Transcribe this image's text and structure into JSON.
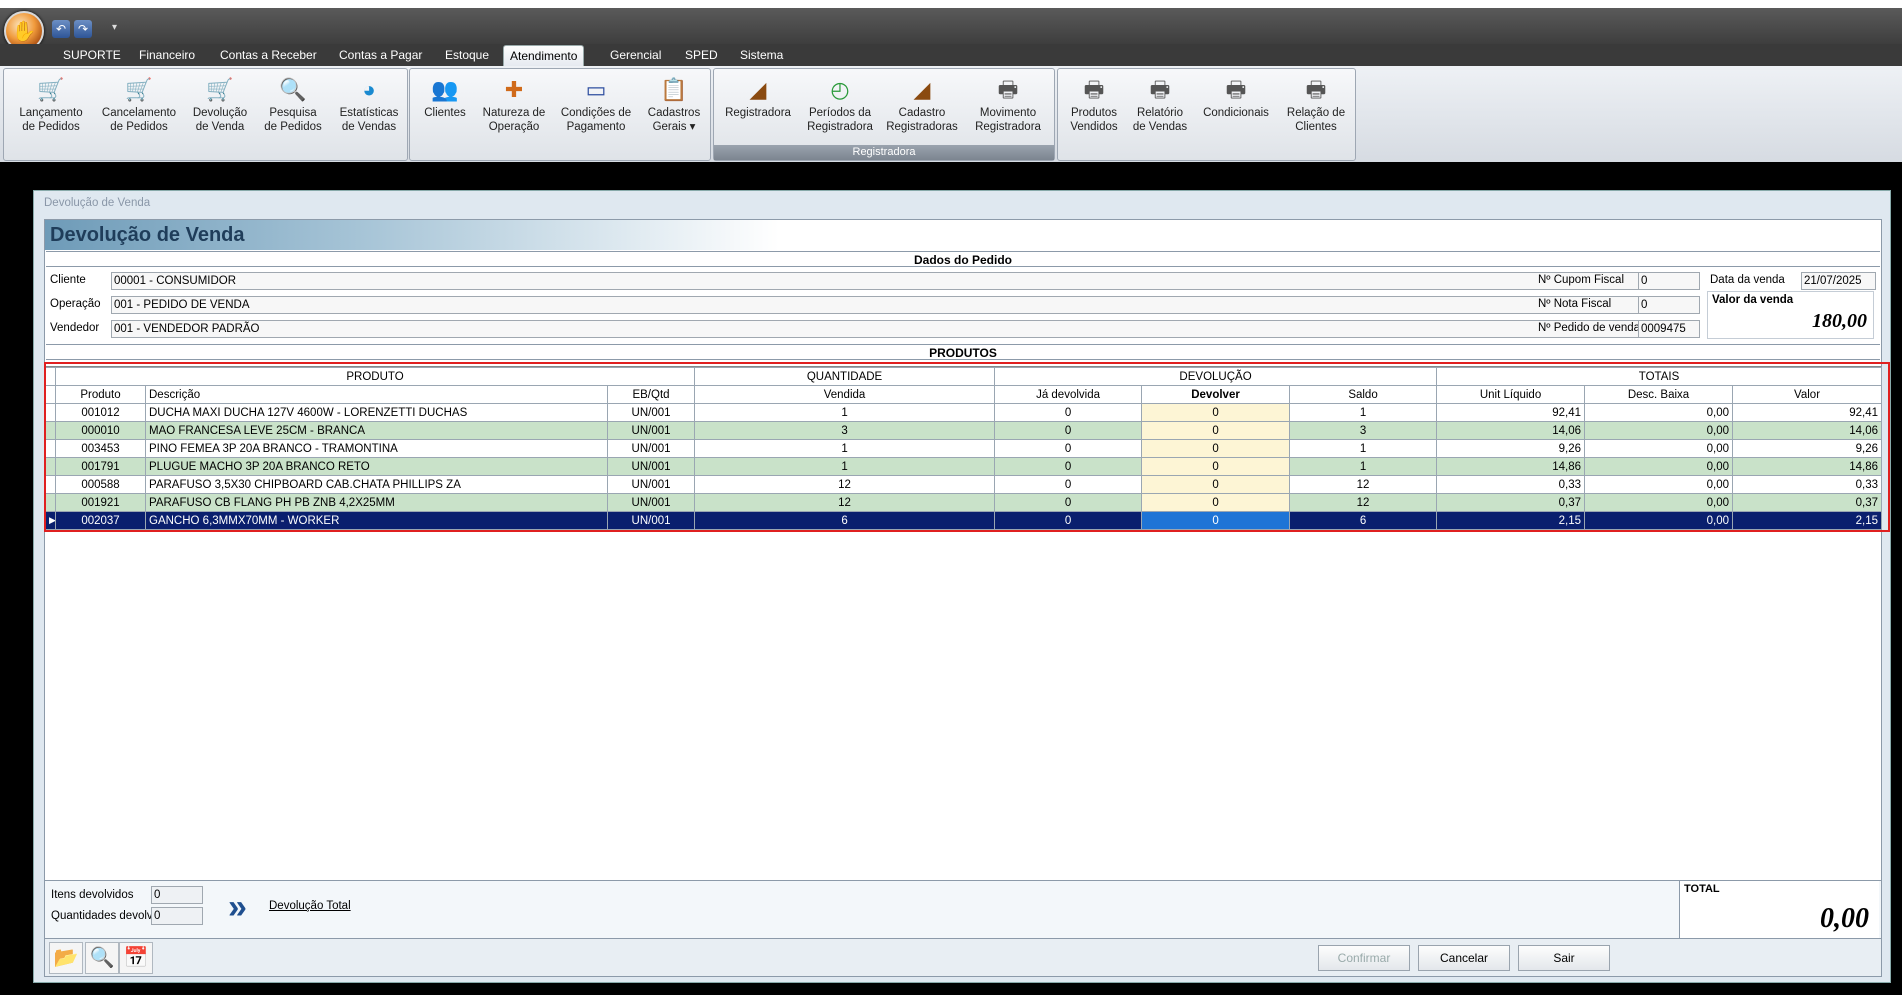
{
  "tabs": [
    "SUPORTE",
    "Financeiro",
    "Contas a Receber",
    "Contas a Pagar",
    "Estoque",
    "Atendimento",
    "Gerencial",
    "SPED",
    "Sistema"
  ],
  "active_tab": "Atendimento",
  "ribbon": {
    "g1": [
      {
        "l1": "Lançamento",
        "l2": "de Pedidos",
        "icon": "cart-icon"
      },
      {
        "l1": "Cancelamento",
        "l2": "de Pedidos",
        "icon": "cart-cancel-icon"
      },
      {
        "l1": "Devolução",
        "l2": "de Venda",
        "icon": "cart-return-icon"
      },
      {
        "l1": "Pesquisa",
        "l2": "de Pedidos",
        "icon": "search-doc-icon"
      },
      {
        "l1": "Estatísticas",
        "l2": "de Vendas",
        "icon": "pie-chart-icon"
      }
    ],
    "g2": [
      {
        "l1": "Clientes",
        "l2": "",
        "icon": "people-icon"
      },
      {
        "l1": "Natureza de",
        "l2": "Operação",
        "icon": "puzzle-icon"
      },
      {
        "l1": "Condições de",
        "l2": "Pagamento",
        "icon": "card-icon"
      },
      {
        "l1": "Cadastros",
        "l2": "Gerais ▾",
        "icon": "clipboard-icon"
      }
    ],
    "g3": [
      {
        "l1": "Registradora",
        "l2": "",
        "icon": "register-icon"
      },
      {
        "l1": "Períodos da",
        "l2": "Registradora",
        "icon": "clock-24-icon"
      },
      {
        "l1": "Cadastro",
        "l2": "Registradoras",
        "icon": "register-icon"
      },
      {
        "l1": "Movimento",
        "l2": "Registradora",
        "icon": "printer-icon"
      }
    ],
    "g3_label": "Registradora",
    "g4": [
      {
        "l1": "Produtos",
        "l2": "Vendidos",
        "icon": "printer-icon"
      },
      {
        "l1": "Relatório",
        "l2": "de Vendas",
        "icon": "printer-icon"
      },
      {
        "l1": "Condicionais",
        "l2": "",
        "icon": "printer-icon"
      },
      {
        "l1": "Relação de",
        "l2": "Clientes",
        "icon": "printer-icon"
      }
    ]
  },
  "window_title": "Devolução de Venda",
  "page_title": "Devolução de Venda",
  "dados_title": "Dados do Pedido",
  "cliente_label": "Cliente",
  "cliente": "00001 - CONSUMIDOR",
  "operacao_label": "Operação",
  "operacao": "001 - PEDIDO DE VENDA",
  "vendedor_label": "Vendedor",
  "vendedor": "001 - VENDEDOR PADRÃO",
  "cupom_label": "Nº Cupom Fiscal",
  "cupom": "0",
  "nota_label": "Nº Nota Fiscal",
  "nota": "0",
  "pedido_label": "Nº Pedido de venda",
  "pedido": "0009475",
  "data_label": "Data da venda",
  "data": "21/07/2025",
  "valor_label": "Valor da venda",
  "valor": "180,00",
  "produtos_title": "PRODUTOS",
  "group_headers": [
    "PRODUTO",
    "QUANTIDADE",
    "DEVOLUÇÃO",
    "TOTAIS"
  ],
  "columns": [
    "Produto",
    "Descrição",
    "EB/Qtd",
    "Vendida",
    "Já devolvida",
    "Devolver",
    "Saldo",
    "Unit Líquido",
    "Desc. Baixa",
    "Valor"
  ],
  "rows": [
    [
      "001012",
      "DUCHA MAXI DUCHA 127V 4600W - LORENZETTI DUCHAS",
      "UN/001",
      "1",
      "0",
      "0",
      "1",
      "92,41",
      "0,00",
      "92,41"
    ],
    [
      "000010",
      "MAO FRANCESA LEVE 25CM - BRANCA",
      "UN/001",
      "3",
      "0",
      "0",
      "3",
      "14,06",
      "0,00",
      "14,06"
    ],
    [
      "003453",
      "PINO FEMEA 3P 20A BRANCO - TRAMONTINA",
      "UN/001",
      "1",
      "0",
      "0",
      "1",
      "9,26",
      "0,00",
      "9,26"
    ],
    [
      "001791",
      "PLUGUE MACHO 3P 20A BRANCO RETO",
      "UN/001",
      "1",
      "0",
      "0",
      "1",
      "14,86",
      "0,00",
      "14,86"
    ],
    [
      "000588",
      "PARAFUSO 3,5X30 CHIPBOARD CAB.CHATA PHILLIPS ZA",
      "UN/001",
      "12",
      "0",
      "0",
      "12",
      "0,33",
      "0,00",
      "0,33"
    ],
    [
      "001921",
      "PARAFUSO CB FLANG PH PB ZNB 4,2X25MM",
      "UN/001",
      "12",
      "0",
      "0",
      "12",
      "0,37",
      "0,00",
      "0,37"
    ],
    [
      "002037",
      "GANCHO 6,3MMX70MM - WORKER",
      "UN/001",
      "6",
      "0",
      "0",
      "6",
      "2,15",
      "0,00",
      "2,15"
    ]
  ],
  "selected_row": 6,
  "itens_label": "Itens devolvidos",
  "itens": "0",
  "qtd_label": "Quantidades devolvidas",
  "qtd": "0",
  "devolucao_total": "Devolução Total",
  "total_label": "TOTAL",
  "total": "0,00",
  "buttons": {
    "confirmar": "Confirmar",
    "cancelar": "Cancelar",
    "sair": "Sair"
  },
  "colors": {
    "row_alt": "#c9e2c9",
    "selected": "#0a1f6e",
    "devolver_cell": "#fdf5d5",
    "highlight": "#e02020"
  }
}
